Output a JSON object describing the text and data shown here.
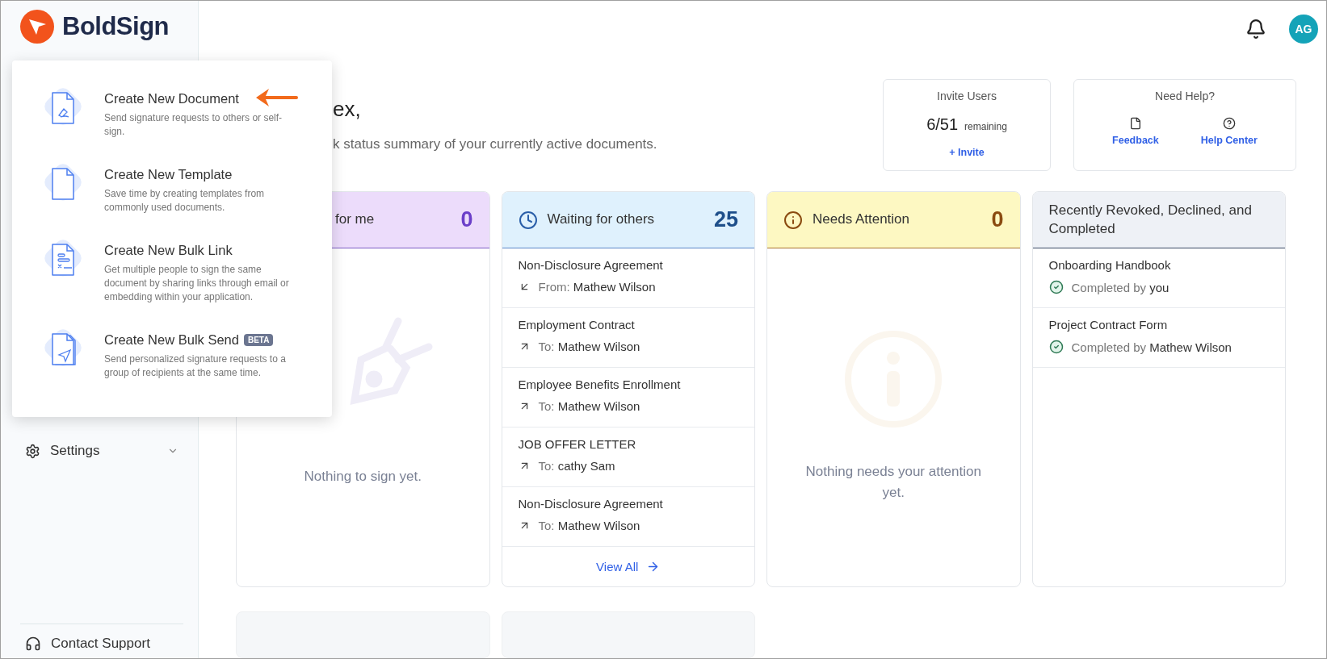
{
  "brand": {
    "name": "BoldSign"
  },
  "header": {
    "avatar_initials": "AG"
  },
  "sidebar": {
    "items": [
      {
        "label": "Settings",
        "expanded": false
      }
    ],
    "footer": {
      "label": "Contact Support"
    }
  },
  "create_menu": {
    "items": [
      {
        "kind": "document",
        "title": "Create New Document",
        "description": "Send signature requests to others or self-sign.",
        "pointed": true
      },
      {
        "kind": "template",
        "title": "Create New Template",
        "description": "Save time by creating templates from commonly used documents.",
        "pointed": false
      },
      {
        "kind": "bulk_link",
        "title": "Create New Bulk Link",
        "description": "Get multiple people to sign the same document by sharing links through email or embedding within your application.",
        "pointed": false
      },
      {
        "kind": "bulk_send",
        "title": "Create New Bulk Send",
        "badge": "BETA",
        "description": "Send personalized signature requests to a group of recipients at the same time.",
        "pointed": false
      }
    ]
  },
  "greeting": {
    "title": "ex,",
    "subtitle": "k status summary of your currently active documents."
  },
  "invite_users": {
    "title": "Invite Users",
    "count": "6/51",
    "count_note": "remaining",
    "action": "+ Invite"
  },
  "need_help": {
    "title": "Need Help?",
    "links": [
      {
        "label": "Feedback"
      },
      {
        "label": "Help Center"
      }
    ]
  },
  "status_cards": [
    {
      "title": "for me",
      "count": "0",
      "empty_text": "Nothing to sign yet."
    },
    {
      "title": "Waiting for others",
      "count": "25",
      "items": [
        {
          "name": "Non-Disclosure Agreement",
          "kind": "received",
          "prefix": "From:",
          "party": "Mathew Wilson"
        },
        {
          "name": "Employment Contract",
          "kind": "sent",
          "prefix": "To:",
          "party": "Mathew Wilson"
        },
        {
          "name": "Employee Benefits Enrollment",
          "kind": "sent",
          "prefix": "To:",
          "party": "Mathew Wilson"
        },
        {
          "name": "JOB OFFER LETTER",
          "kind": "sent",
          "prefix": "To:",
          "party": "cathy Sam"
        },
        {
          "name": "Non-Disclosure Agreement",
          "kind": "sent",
          "prefix": "To:",
          "party": "Mathew Wilson"
        }
      ],
      "view_all": "View All"
    },
    {
      "title": "Needs Attention",
      "count": "0",
      "empty_text": "Nothing needs your attention yet."
    },
    {
      "title": "Recently Revoked, Declined, and Completed",
      "items": [
        {
          "name": "Onboarding Handbook",
          "kind": "completed",
          "prefix": "Completed by",
          "party": "you"
        },
        {
          "name": "Project Contract Form",
          "kind": "completed",
          "prefix": "Completed by",
          "party": "Mathew Wilson"
        }
      ]
    }
  ]
}
